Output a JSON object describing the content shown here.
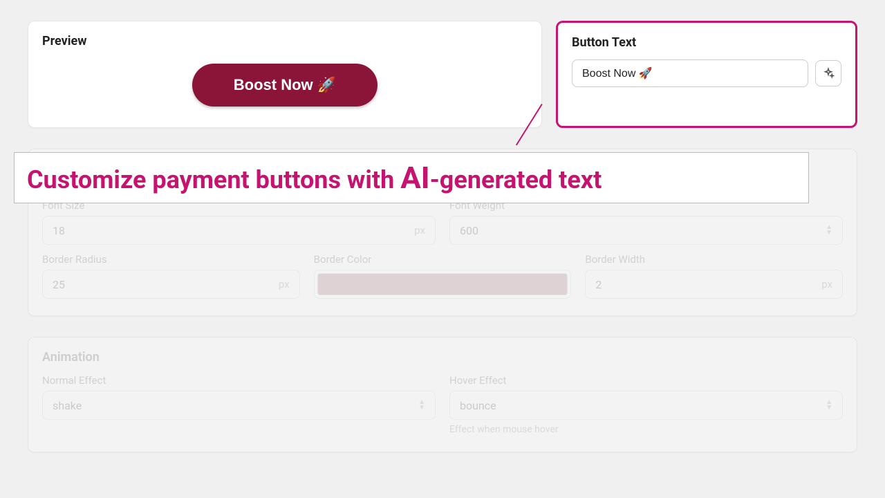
{
  "preview": {
    "title": "Preview",
    "button_label": "Boost Now 🚀"
  },
  "button_text": {
    "title": "Button Text",
    "value": "Boost Now 🚀",
    "ai_icon": "sparkle-icon"
  },
  "styles": {
    "bg_color": "#8b1538",
    "text_color": "#e8e8e8",
    "font_size": {
      "label": "Font Size",
      "value": "18",
      "unit": "px"
    },
    "font_weight": {
      "label": "Font Weight",
      "value": "600"
    },
    "border_radius": {
      "label": "Border Radius",
      "value": "25",
      "unit": "px"
    },
    "border_color": {
      "label": "Border Color",
      "value": "#8b5a66"
    },
    "border_width": {
      "label": "Border Width",
      "value": "2",
      "unit": "px"
    }
  },
  "animation": {
    "title": "Animation",
    "normal": {
      "label": "Normal Effect",
      "value": "shake"
    },
    "hover": {
      "label": "Hover Effect",
      "value": "bounce",
      "hint": "Effect when mouse hover"
    }
  },
  "callout": {
    "pre": "Customize payment buttons with ",
    "ai": "AI",
    "post": "-generated text"
  }
}
